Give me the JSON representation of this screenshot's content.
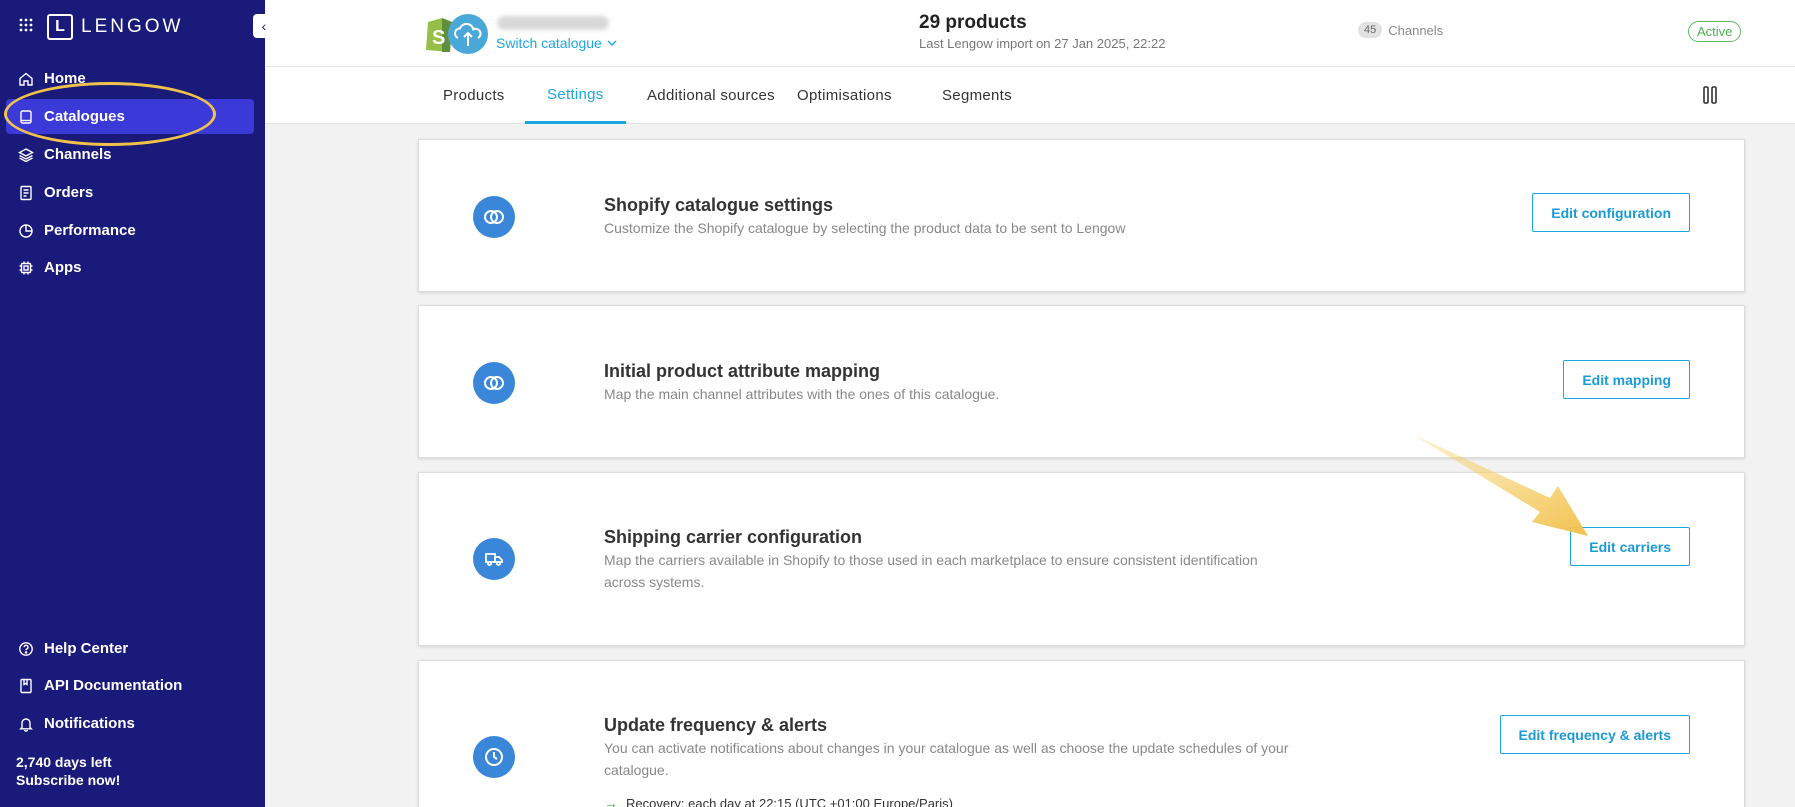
{
  "sidebar": {
    "brand": "LENGOW",
    "brand_mark": "L",
    "items": [
      {
        "label": "Home",
        "icon": "home-icon"
      },
      {
        "label": "Catalogues",
        "icon": "book-icon"
      },
      {
        "label": "Channels",
        "icon": "layers-icon"
      },
      {
        "label": "Orders",
        "icon": "receipt-icon"
      },
      {
        "label": "Performance",
        "icon": "pie-chart-icon"
      },
      {
        "label": "Apps",
        "icon": "chip-icon"
      }
    ],
    "bottom_items": [
      {
        "label": "Help Center",
        "icon": "help-icon"
      },
      {
        "label": "API Documentation",
        "icon": "doc-icon"
      },
      {
        "label": "Notifications",
        "icon": "bell-icon"
      }
    ],
    "days_left": "2,740 days left",
    "subscribe": "Subscribe now!",
    "colors": {
      "background": "#1a1a7a",
      "active": "#3b39d8",
      "highlight": "#f0c24b"
    }
  },
  "header": {
    "switch_catalogue": "Switch catalogue",
    "product_count": "29 products",
    "last_import": "Last Lengow import on 27 Jan 2025, 22:22",
    "channels_count": "45",
    "channels_label": "Channels",
    "status": "Active"
  },
  "tabs": [
    {
      "label": "Products"
    },
    {
      "label": "Settings"
    },
    {
      "label": "Additional sources"
    },
    {
      "label": "Optimisations"
    },
    {
      "label": "Segments"
    }
  ],
  "cards": [
    {
      "title": "Shopify catalogue settings",
      "desc": "Customize the Shopify catalogue by selecting the product data to be sent to Lengow",
      "button": "Edit configuration",
      "icon": "rings-icon"
    },
    {
      "title": "Initial product attribute mapping",
      "desc": "Map the main channel attributes with the ones of this catalogue.",
      "button": "Edit mapping",
      "icon": "rings-icon"
    },
    {
      "title": "Shipping carrier configuration",
      "desc": "Map the carriers available in Shopify to those used in each marketplace to ensure consistent identification across systems.",
      "button": "Edit carriers",
      "icon": "truck-icon"
    },
    {
      "title": "Update frequency & alerts",
      "desc": "You can activate notifications about changes in your catalogue as well as choose the update schedules of your catalogue.",
      "button": "Edit frequency & alerts",
      "icon": "clock-icon",
      "recovery": "Recovery: each day at 22:15 (UTC +01:00 Europe/Paris)"
    }
  ],
  "accent_color": "#1aa7e0"
}
